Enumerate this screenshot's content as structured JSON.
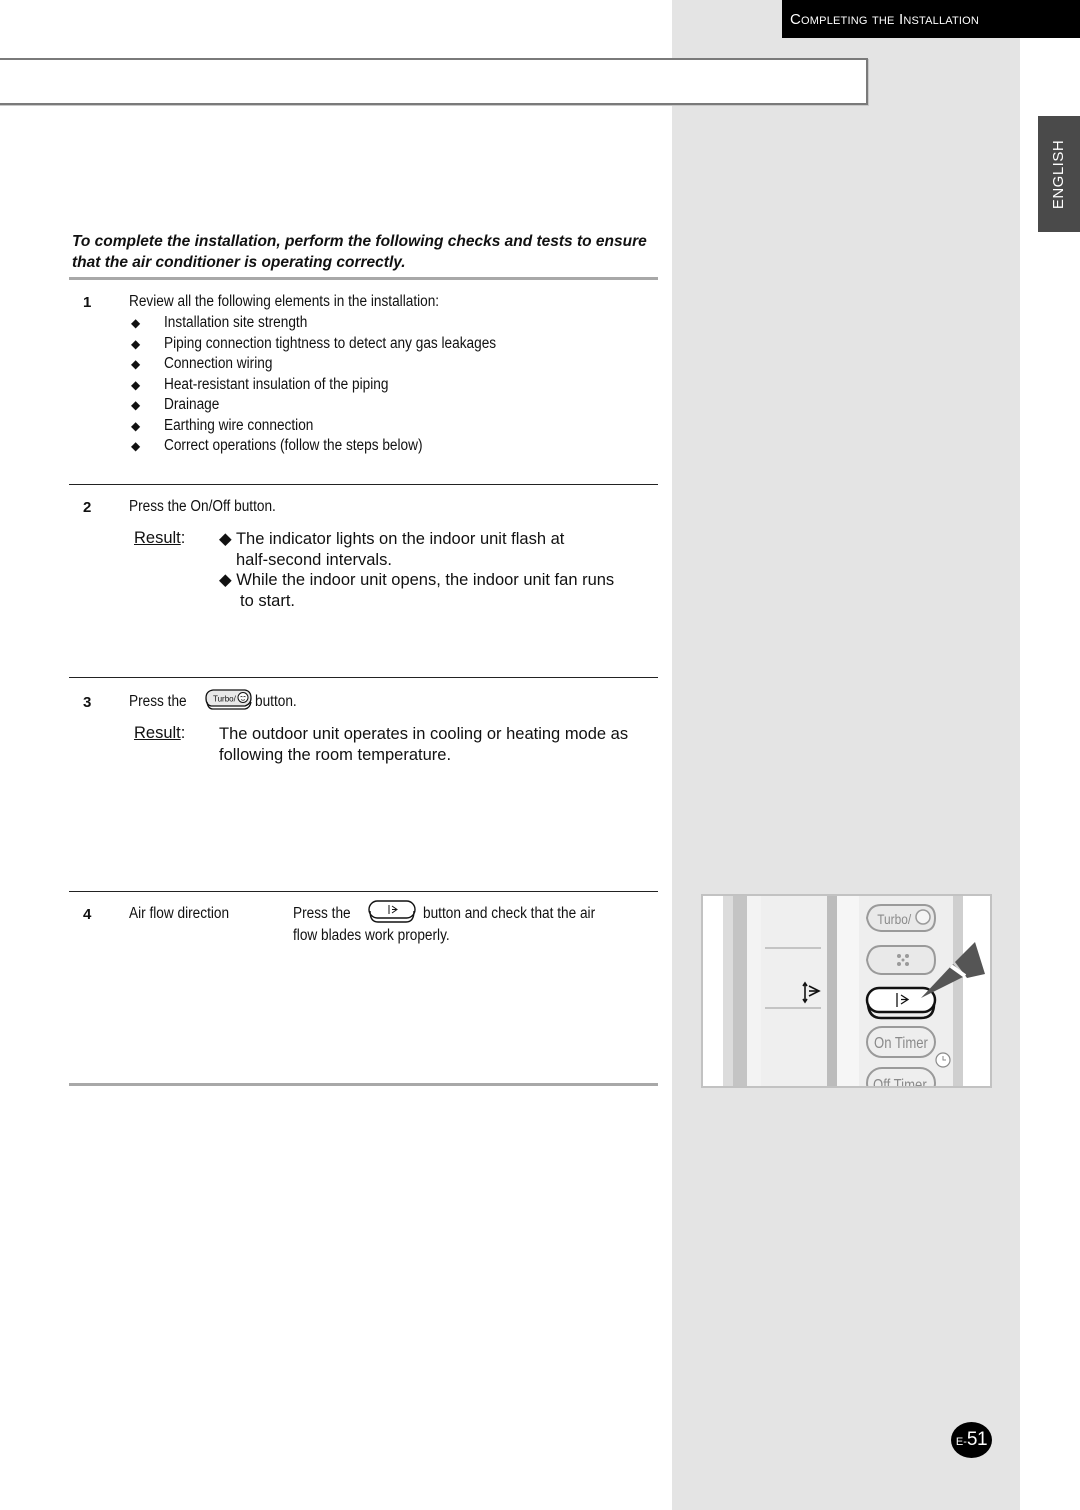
{
  "header": {
    "section_title": "Completing the Installation"
  },
  "language_tab": "ENGLISH",
  "intro": "To complete the installation, perform the following checks and tests to ensure that the air conditioner is operating correctly.",
  "steps": [
    {
      "number": "1",
      "text": "Review all the following elements in the installation:",
      "bullets": [
        "Installation site strength",
        "Piping connection tightness to detect any gas leakages",
        "Connection wiring",
        "Heat-resistant insulation of the piping",
        "Drainage",
        "Earthing wire connection",
        "Correct operations (follow the steps below)"
      ]
    },
    {
      "number": "2",
      "text": "Press the On/Off button.",
      "result_label": "Result",
      "result_lines": [
        "◆ The indicator lights on the indoor unit flash at",
        "half-second intervals.",
        "◆ While the indoor unit opens, the indoor unit fan runs",
        "to start."
      ]
    },
    {
      "number": "3",
      "text_before": "Press the",
      "button_icon": "turbo-sleep-button",
      "button_label": "Turbo/",
      "text_after": "button.",
      "result_label": "Result",
      "result_lines": [
        "The outdoor unit operates in cooling or heating mode as",
        "following the room temperature."
      ]
    },
    {
      "number": "4",
      "label": "Air flow direction",
      "text_before": "Press the",
      "button_icon": "air-swing-button",
      "text_after": "button and check that the air",
      "text_line2": "flow blades work properly."
    }
  ],
  "illustration": {
    "remote_buttons": [
      "Turbo/",
      "fan-speed",
      "air-swing",
      "On Timer",
      "Off Timer"
    ],
    "highlighted": "air-swing"
  },
  "page_number": {
    "prefix": "E-",
    "number": "51"
  }
}
